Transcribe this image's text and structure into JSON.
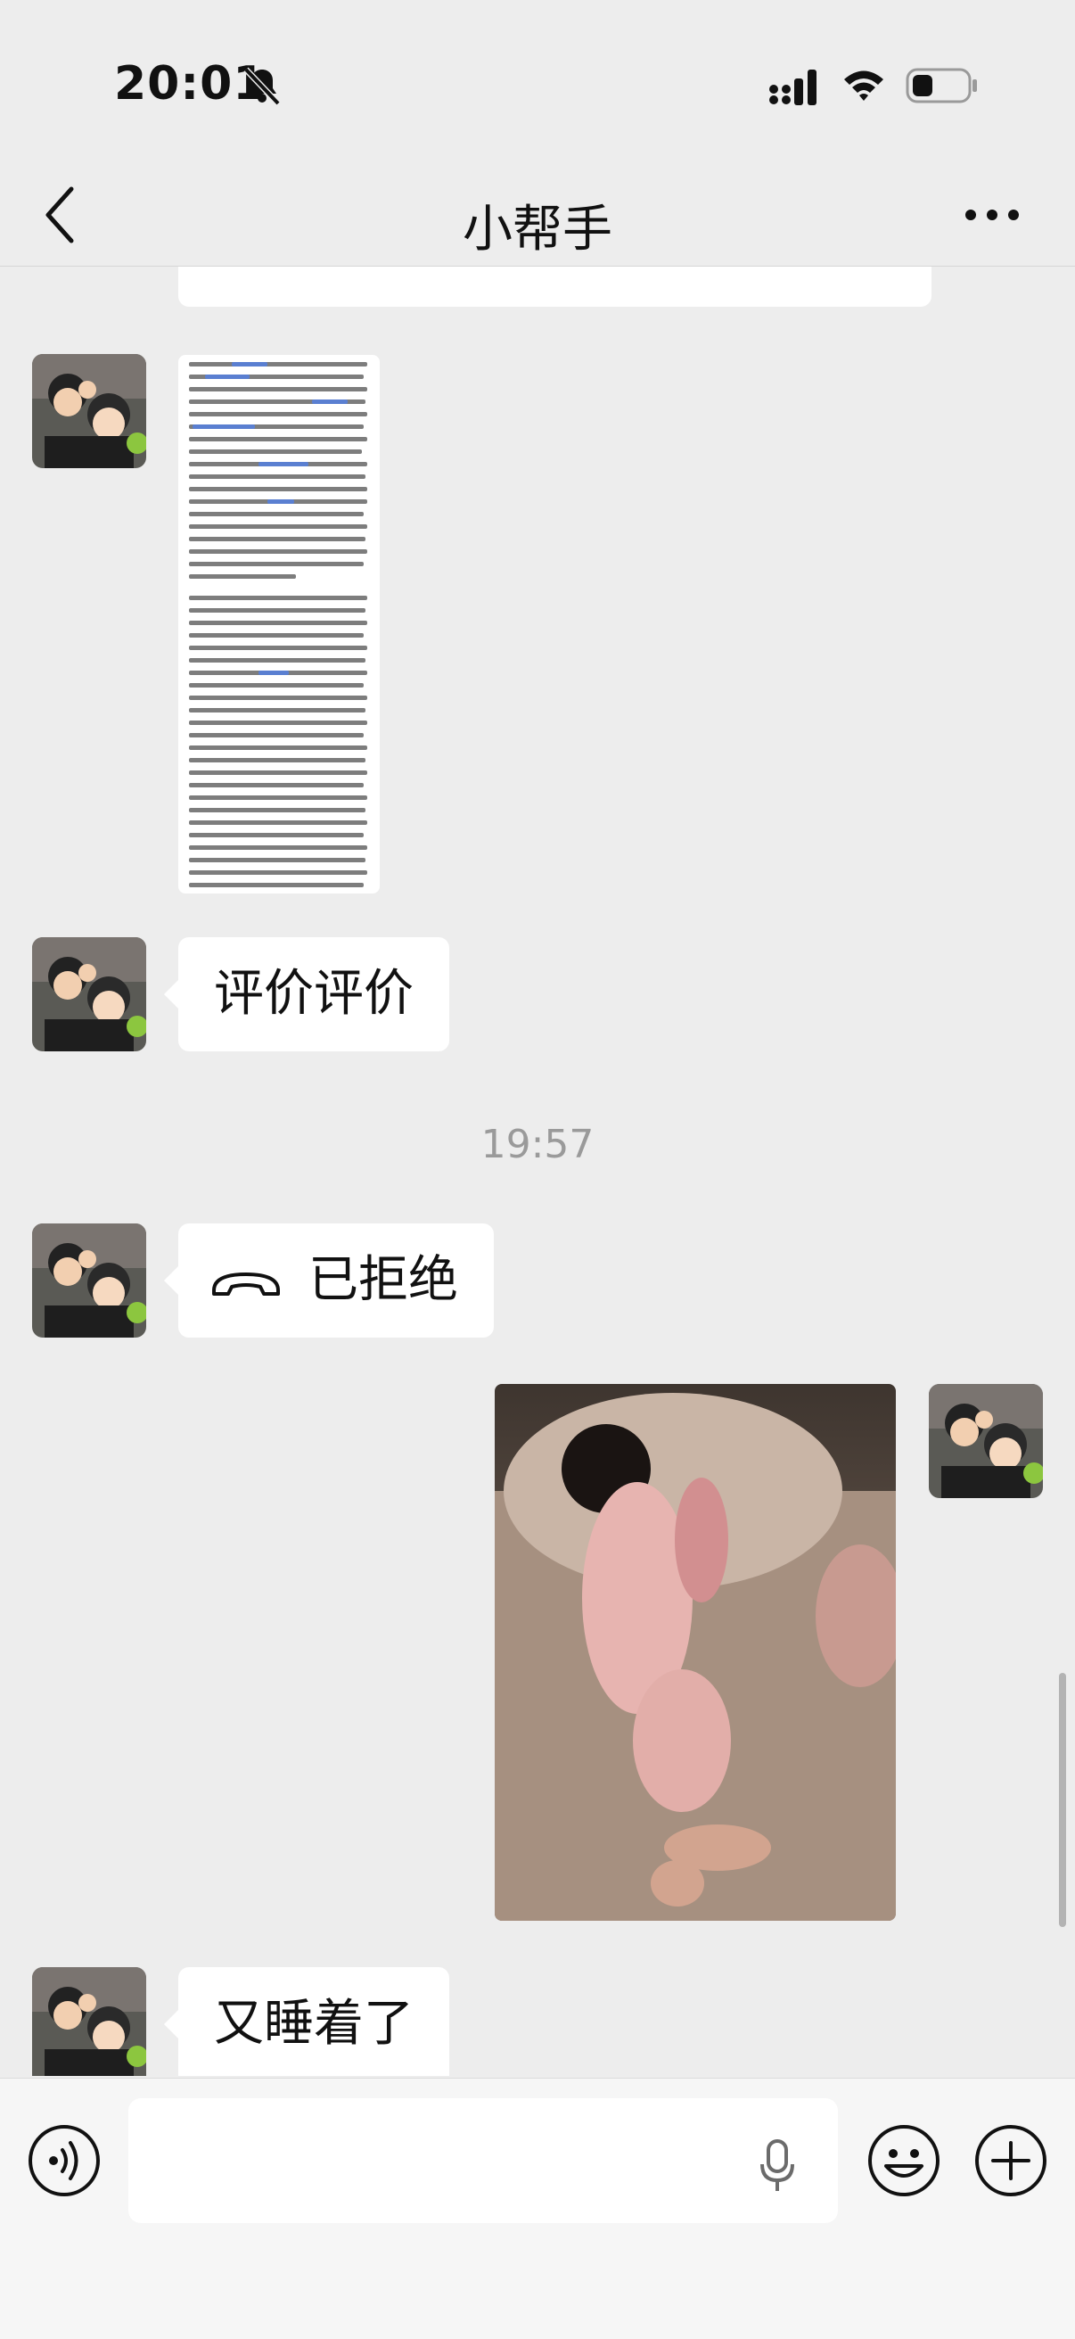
{
  "status_bar": {
    "time": "20:01"
  },
  "header": {
    "title": "小帮手"
  },
  "messages": {
    "m1_text": "评价评价",
    "timestamp": "19:57",
    "call_status": "已拒绝",
    "m2_text": "又睡着了"
  },
  "input": {
    "value": "",
    "placeholder": ""
  },
  "colors": {
    "background": "#ededed",
    "bubble": "#ffffff",
    "timestamp": "#9a9a9a"
  }
}
